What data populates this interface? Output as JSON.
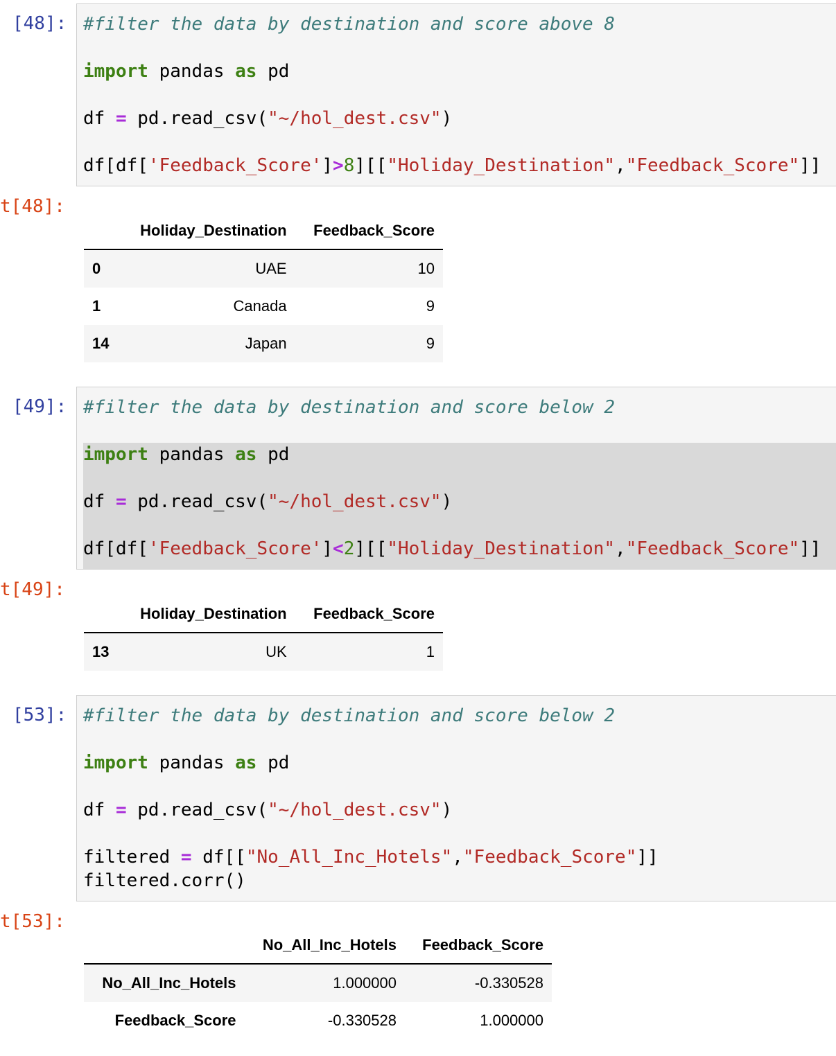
{
  "cells": [
    {
      "in_prompt": "[48]:",
      "out_prompt": "t[48]:",
      "comment": "#filter the data by destination and score above 8",
      "line_import": [
        "import",
        " pandas ",
        "as",
        " pd"
      ],
      "line_read": [
        "df ",
        "=",
        " pd.read_csv(",
        "\"~/hol_dest.csv\"",
        ")"
      ],
      "line_filter": [
        "df[df[",
        "'Feedback_Score'",
        "]",
        ">",
        "8",
        "][[",
        "\"Holiday_Destination\"",
        ",",
        "\"Feedback_Score\"",
        "]]"
      ],
      "table": {
        "columns": [
          "Holiday_Destination",
          "Feedback_Score"
        ],
        "rows": [
          {
            "index": "0",
            "cells": [
              "UAE",
              "10"
            ]
          },
          {
            "index": "1",
            "cells": [
              "Canada",
              "9"
            ]
          },
          {
            "index": "14",
            "cells": [
              "Japan",
              "9"
            ]
          }
        ]
      }
    },
    {
      "in_prompt": "[49]:",
      "out_prompt": "t[49]:",
      "comment": "#filter the data by destination and score below 2",
      "line_import": [
        "import",
        " pandas ",
        "as",
        " pd"
      ],
      "line_read": [
        "df ",
        "=",
        " pd.read_csv(",
        "\"~/hol_dest.csv\"",
        ")"
      ],
      "line_filter": [
        "df[df[",
        "'Feedback_Score'",
        "]",
        "<",
        "2",
        "][[",
        "\"Holiday_Destination\"",
        ",",
        "\"Feedback_Score\"",
        "]]"
      ],
      "table": {
        "columns": [
          "Holiday_Destination",
          "Feedback_Score"
        ],
        "rows": [
          {
            "index": "13",
            "cells": [
              "UK",
              "1"
            ]
          }
        ]
      }
    },
    {
      "in_prompt": "[53]:",
      "out_prompt": "t[53]:",
      "comment": "#filter the data by destination and score below 2",
      "line_import": [
        "import",
        " pandas ",
        "as",
        " pd"
      ],
      "line_read": [
        "df ",
        "=",
        " pd.read_csv(",
        "\"~/hol_dest.csv\"",
        ")"
      ],
      "line_filtered": [
        "filtered ",
        "=",
        " df[[",
        "\"No_All_Inc_Hotels\"",
        ",",
        "\"Feedback_Score\"",
        "]]"
      ],
      "line_corr": "filtered.corr()",
      "table": {
        "columns": [
          "No_All_Inc_Hotels",
          "Feedback_Score"
        ],
        "rows": [
          {
            "index": "No_All_Inc_Hotels",
            "cells": [
              "1.000000",
              "-0.330528"
            ]
          },
          {
            "index": "Feedback_Score",
            "cells": [
              "-0.330528",
              "1.000000"
            ]
          }
        ]
      }
    }
  ]
}
